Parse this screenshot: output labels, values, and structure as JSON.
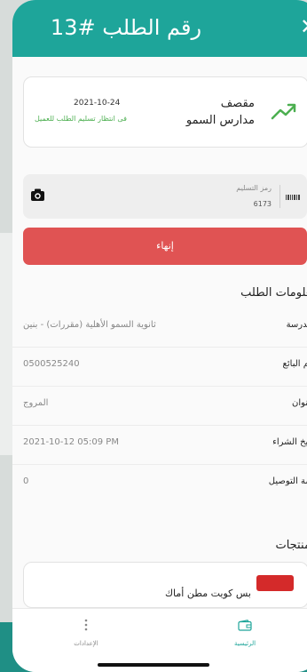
{
  "header": {
    "title": "رقم الطلب #13",
    "close_icon": "close-icon"
  },
  "order": {
    "name": "مقصف مدارس السمو",
    "date": "2021-10-24",
    "status": "فى انتظار تسليم الطلب للعميل",
    "icon": "trend-up-icon",
    "status_color": "#4caf50"
  },
  "delivery_code": {
    "label": "رمز التسليم",
    "value": "6173"
  },
  "finish_button": {
    "label": "إنهاء",
    "color": "#e05353"
  },
  "order_info": {
    "title": "معلومات الطلب",
    "rows": [
      {
        "label": "المدرسة",
        "value": "ثانوية السمو الأهلية (مقررات) - بنين"
      },
      {
        "label": "رقم البائع",
        "value": "0500525240"
      },
      {
        "label": "العنوان",
        "value": "المروج"
      },
      {
        "label": "تاريخ الشراء",
        "value": "2021-10-12 05:09 PM"
      },
      {
        "label": "قيمة التوصيل",
        "value": "0"
      }
    ]
  },
  "products": {
    "title": "المنتجات",
    "items": [
      {
        "name": "بس كويت مطن أماك"
      }
    ]
  },
  "tabbar": {
    "settings": "الإعدادات",
    "home": "الرئيسية",
    "active_color": "#1ea59a"
  },
  "colors": {
    "accent": "#1ea59a"
  }
}
